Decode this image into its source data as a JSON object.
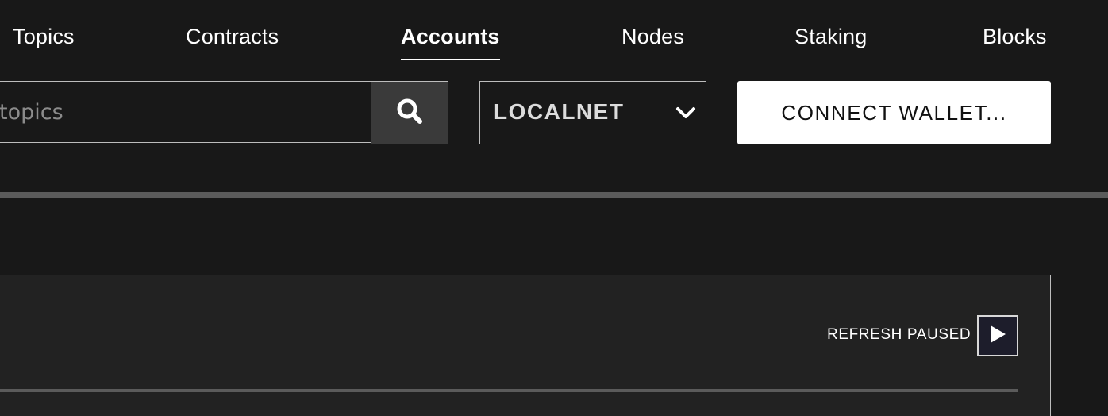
{
  "nav": {
    "items": [
      {
        "label": "Topics",
        "active": false
      },
      {
        "label": "Contracts",
        "active": false
      },
      {
        "label": "Accounts",
        "active": true
      },
      {
        "label": "Nodes",
        "active": false
      },
      {
        "label": "Staking",
        "active": false
      },
      {
        "label": "Blocks",
        "active": false
      }
    ]
  },
  "search": {
    "placeholder": "topics",
    "value": "",
    "button_icon": "search-icon"
  },
  "network": {
    "selected": "LOCALNET",
    "icon": "chevron-down-icon"
  },
  "wallet": {
    "connect_label": "CONNECT WALLET..."
  },
  "panel": {
    "refresh_status": "REFRESH PAUSED",
    "play_icon": "play-icon"
  },
  "colors": {
    "background": "#181818",
    "panel_background": "#222222",
    "divider": "#5b5b5b",
    "border": "#bdbdbd",
    "button_light": "#ffffff",
    "play_button_bg": "#1d1d2b"
  }
}
